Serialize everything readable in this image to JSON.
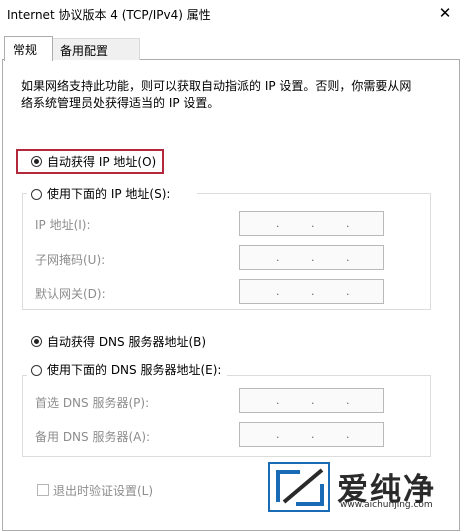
{
  "window": {
    "title": "Internet 协议版本 4 (TCP/IPv4) 属性",
    "close_icon": "close-icon"
  },
  "tabs": [
    {
      "label": "常规",
      "active": true
    },
    {
      "label": "备用配置",
      "active": false
    }
  ],
  "description": {
    "line1": "如果网络支持此功能，则可以获取自动指派的 IP 设置。否则，你需要从网",
    "line2": "络系统管理员处获得适当的 IP 设置。"
  },
  "ip": {
    "auto_label": "自动获得 IP 地址(O)",
    "auto_selected": true,
    "manual_label": "使用下面的 IP 地址(S):",
    "fields": [
      {
        "label": "IP 地址(I):",
        "value": ". . ."
      },
      {
        "label": "子网掩码(U):",
        "value": ". . ."
      },
      {
        "label": "默认网关(D):",
        "value": ". . ."
      }
    ]
  },
  "dns": {
    "auto_label": "自动获得 DNS 服务器地址(B)",
    "auto_selected": true,
    "manual_label": "使用下面的 DNS 服务器地址(E):",
    "fields": [
      {
        "label": "首选 DNS 服务器(P):",
        "value": ". . ."
      },
      {
        "label": "备用 DNS 服务器(A):",
        "value": ". . ."
      }
    ]
  },
  "validate": {
    "label": "退出时验证设置(L)",
    "checked": false
  },
  "watermark": {
    "name": "爱纯净",
    "url": "www.aichunjing.com"
  },
  "colors": {
    "highlight": "#b4283c",
    "disabled_text": "#8d8d8d",
    "watermark_blue": "#1a6bb5"
  }
}
